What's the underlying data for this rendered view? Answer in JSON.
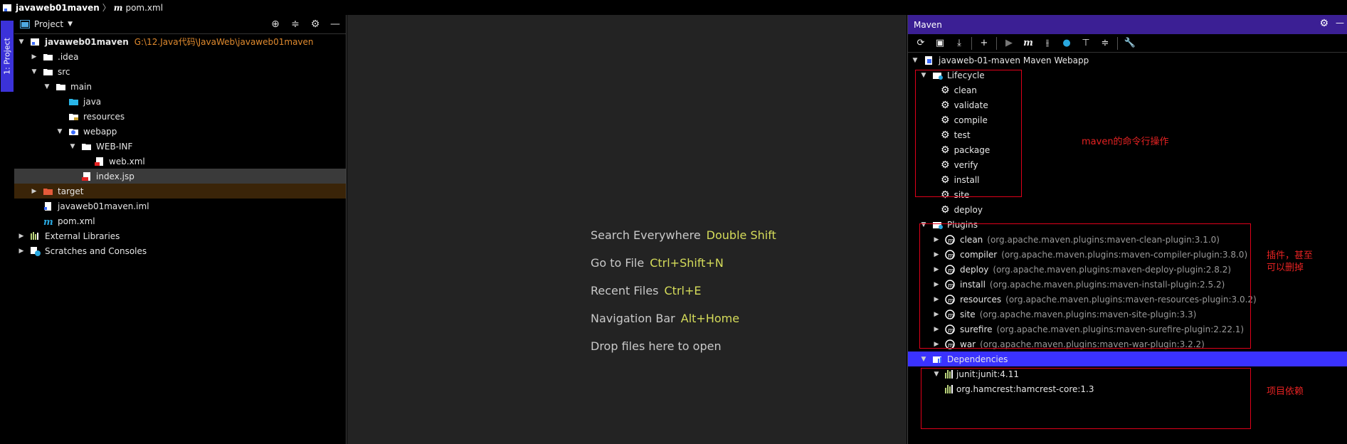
{
  "nav": {
    "project": "javaweb01maven",
    "file": "pom.xml"
  },
  "side_strip": {
    "tab_label": "1: Project"
  },
  "project_panel": {
    "title": "Project",
    "tree": [
      {
        "label": "javaweb01maven",
        "path": "G:\\12.Java代码\\JavaWeb\\javaweb01maven",
        "level": 0,
        "arrow": "▼",
        "icon": "module-icon"
      },
      {
        "label": ".idea",
        "level": 1,
        "arrow": "▶",
        "icon": "folder-icon"
      },
      {
        "label": "src",
        "level": 1,
        "arrow": "▼",
        "icon": "folder-icon"
      },
      {
        "label": "main",
        "level": 2,
        "arrow": "▼",
        "icon": "folder-icon"
      },
      {
        "label": "java",
        "level": 3,
        "arrow": "",
        "icon": "source-folder-icon"
      },
      {
        "label": "resources",
        "level": 3,
        "arrow": "",
        "icon": "resources-folder-icon"
      },
      {
        "label": "webapp",
        "level": 3,
        "arrow": "▼",
        "icon": "web-folder-icon"
      },
      {
        "label": "WEB-INF",
        "level": 4,
        "arrow": "▼",
        "icon": "folder-icon"
      },
      {
        "label": "web.xml",
        "level": 5,
        "arrow": "",
        "icon": "xml-file-icon"
      },
      {
        "label": "index.jsp",
        "level": 4,
        "arrow": "",
        "icon": "jsp-file-icon"
      },
      {
        "label": "target",
        "level": 1,
        "arrow": "▶",
        "icon": "excluded-folder-icon"
      },
      {
        "label": "javaweb01maven.iml",
        "level": 1,
        "arrow": "",
        "icon": "iml-file-icon"
      },
      {
        "label": "pom.xml",
        "level": 1,
        "arrow": "",
        "icon": "maven-file-icon"
      },
      {
        "label": "External Libraries",
        "level": 0,
        "arrow": "▶",
        "icon": "library-icon"
      },
      {
        "label": "Scratches and Consoles",
        "level": 0,
        "arrow": "▶",
        "icon": "scratches-icon"
      }
    ]
  },
  "editor": {
    "hints": [
      {
        "text": "Search Everywhere",
        "key": "Double Shift"
      },
      {
        "text": "Go to File",
        "key": "Ctrl+Shift+N"
      },
      {
        "text": "Recent Files",
        "key": "Ctrl+E"
      },
      {
        "text": "Navigation Bar",
        "key": "Alt+Home"
      },
      {
        "text": "Drop files here to open",
        "key": ""
      }
    ]
  },
  "maven": {
    "title": "Maven",
    "project": "javaweb-01-maven Maven Webapp",
    "lifecycle_label": "Lifecycle",
    "lifecycle": [
      "clean",
      "validate",
      "compile",
      "test",
      "package",
      "verify",
      "install",
      "site",
      "deploy"
    ],
    "plugins_label": "Plugins",
    "plugins": [
      {
        "name": "clean",
        "coord": "(org.apache.maven.plugins:maven-clean-plugin:3.1.0)"
      },
      {
        "name": "compiler",
        "coord": "(org.apache.maven.plugins:maven-compiler-plugin:3.8.0)"
      },
      {
        "name": "deploy",
        "coord": "(org.apache.maven.plugins:maven-deploy-plugin:2.8.2)"
      },
      {
        "name": "install",
        "coord": "(org.apache.maven.plugins:maven-install-plugin:2.5.2)"
      },
      {
        "name": "resources",
        "coord": "(org.apache.maven.plugins:maven-resources-plugin:3.0.2)"
      },
      {
        "name": "site",
        "coord": "(org.apache.maven.plugins:maven-site-plugin:3.3)"
      },
      {
        "name": "surefire",
        "coord": "(org.apache.maven.plugins:maven-surefire-plugin:2.22.1)"
      },
      {
        "name": "war",
        "coord": "(org.apache.maven.plugins:maven-war-plugin:3.2.2)"
      }
    ],
    "dependencies_label": "Dependencies",
    "dependencies": [
      {
        "label": "junit:junit:4.11",
        "level": 0
      },
      {
        "label": "org.hamcrest:hamcrest-core:1.3",
        "level": 1
      }
    ]
  },
  "annotations": {
    "lifecycle_note": "maven的命令行操作",
    "plugins_note": "插件，甚至可以删掉",
    "dependencies_note": "项目依赖"
  },
  "colors": {
    "selection": "#3a32ff",
    "maven_header": "#3b1f94",
    "annotation": "#e0001a",
    "path": "#e08a2e",
    "hint_key": "#d5dc5a"
  }
}
